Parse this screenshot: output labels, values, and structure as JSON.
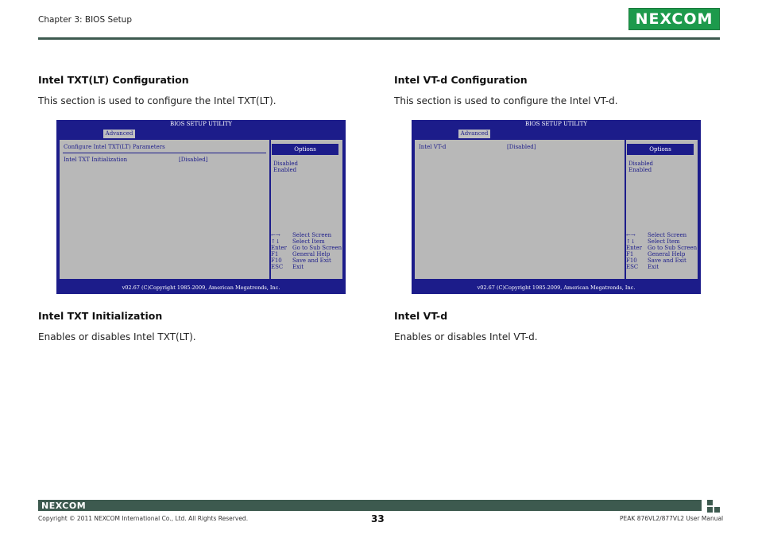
{
  "header": {
    "chapter": "Chapter 3: BIOS Setup",
    "logo_text": "NEXCOM"
  },
  "left": {
    "title": "Intel TXT(LT) Configuration",
    "description": "This section is used to configure the Intel TXT(LT).",
    "sub_title": "Intel TXT Initialization",
    "sub_description": "Enables or disables Intel TXT(LT).",
    "bios": {
      "title": "BIOS SETUP UTILITY",
      "tab": "Advanced",
      "section_header": "Configure Intel TXT(LT) Parameters",
      "item_label": "Intel TXT Initialization",
      "item_value": "[Disabled]",
      "options_header": "Options",
      "options": [
        "Disabled",
        "Enabled"
      ],
      "keys": [
        {
          "key": "←→",
          "desc": "Select Screen"
        },
        {
          "key": "↑↓",
          "desc": "Select Item"
        },
        {
          "key": "Enter",
          "desc": "Go to Sub Screen"
        },
        {
          "key": "F1",
          "desc": "General Help"
        },
        {
          "key": "F10",
          "desc": "Save and Exit"
        },
        {
          "key": "ESC",
          "desc": "Exit"
        }
      ],
      "footer": "v02.67 (C)Copyright 1985-2009, American Megatrends, Inc."
    }
  },
  "right": {
    "title": "Intel VT-d Configuration",
    "description": "This section is used to configure the Intel VT-d.",
    "sub_title": "Intel VT-d",
    "sub_description": "Enables or disables Intel VT-d.",
    "bios": {
      "title": "BIOS SETUP UTILITY",
      "tab": "Advanced",
      "item_label": "Intel VT-d",
      "item_value": "[Disabled]",
      "options_header": "Options",
      "options": [
        "Disabled",
        "Enabled"
      ],
      "keys": [
        {
          "key": "←→",
          "desc": "Select Screen"
        },
        {
          "key": "↑↓",
          "desc": "Select Item"
        },
        {
          "key": "Enter",
          "desc": "Go to Sub Screen"
        },
        {
          "key": "F1",
          "desc": "General Help"
        },
        {
          "key": "F10",
          "desc": "Save and Exit"
        },
        {
          "key": "ESC",
          "desc": "Exit"
        }
      ],
      "footer": "v02.67 (C)Copyright 1985-2009, American Megatrends, Inc."
    }
  },
  "footer": {
    "logo_text": "NEXCOM",
    "copyright": "Copyright © 2011 NEXCOM International Co., Ltd. All Rights Reserved.",
    "page_number": "33",
    "manual": "PEAK 876VL2/877VL2 User Manual"
  },
  "colors": {
    "bios_blue": "#1c1c8a",
    "bios_gray": "#b8b8b8",
    "brand_green": "#1d9a4c",
    "rule_green": "#3d5a4f"
  }
}
